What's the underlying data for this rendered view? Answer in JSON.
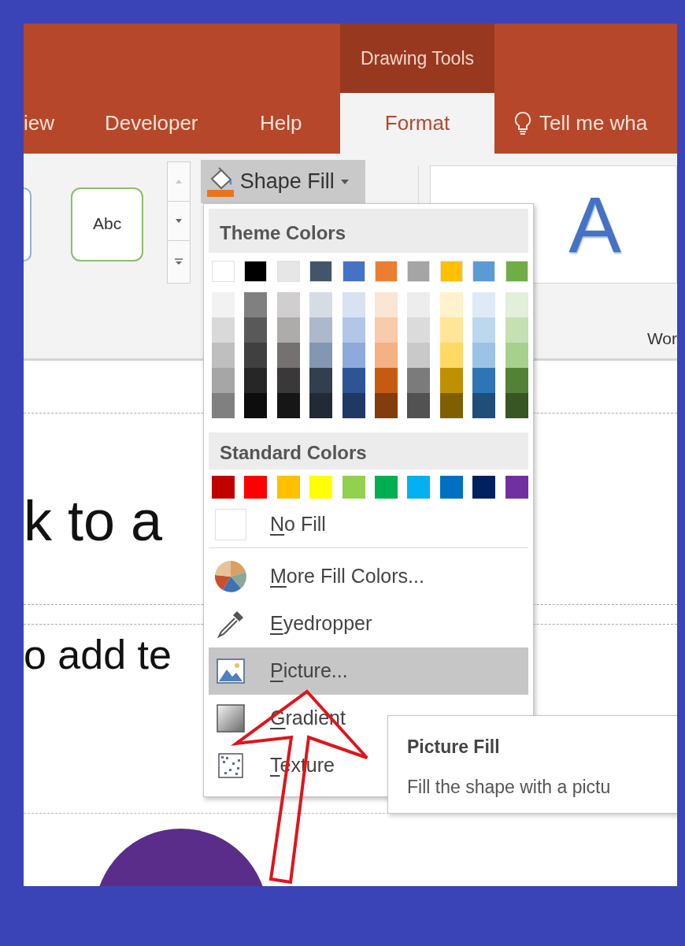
{
  "ribbon": {
    "contextual_label": "Drawing Tools",
    "tabs": [
      {
        "label": "iew",
        "selected": false
      },
      {
        "label": "Developer",
        "selected": false
      },
      {
        "label": "Help",
        "selected": false
      },
      {
        "label": "Format",
        "selected": true
      }
    ],
    "tell_me": "Tell me wha"
  },
  "gallery": {
    "style_preview": "Abc",
    "wordart_preview": "A",
    "group_label": "Wor"
  },
  "shape_fill_button": {
    "label": "Shape Fill",
    "expanded": true
  },
  "menu": {
    "theme_header": "Theme Colors",
    "theme_colors": [
      {
        "color": "#ffffff",
        "shades": [
          {
            "color": "#f2f2f2"
          },
          {
            "color": "#d9d9d9"
          },
          {
            "color": "#bfbfbf"
          },
          {
            "color": "#a6a6a6"
          },
          {
            "color": "#808080"
          }
        ]
      },
      {
        "color": "#000000",
        "shades": [
          {
            "color": "#808080"
          },
          {
            "color": "#595959"
          },
          {
            "color": "#404040"
          },
          {
            "color": "#262626"
          },
          {
            "color": "#0d0d0d"
          }
        ]
      },
      {
        "color": "#e7e6e6",
        "shades": [
          {
            "color": "#d0cece"
          },
          {
            "color": "#aeabab"
          },
          {
            "color": "#757171"
          },
          {
            "color": "#3a3838"
          },
          {
            "color": "#171616"
          }
        ]
      },
      {
        "color": "#44546a",
        "shades": [
          {
            "color": "#d6dce4"
          },
          {
            "color": "#adb9ca"
          },
          {
            "color": "#8497b0"
          },
          {
            "color": "#333f4f"
          },
          {
            "color": "#222a35"
          }
        ]
      },
      {
        "color": "#4472c4",
        "shades": [
          {
            "color": "#d9e2f3"
          },
          {
            "color": "#b4c6e7"
          },
          {
            "color": "#8eaadb"
          },
          {
            "color": "#2f5496"
          },
          {
            "color": "#1f3864"
          }
        ]
      },
      {
        "color": "#ed7d31",
        "shades": [
          {
            "color": "#fbe5d5"
          },
          {
            "color": "#f7cbac"
          },
          {
            "color": "#f4b183"
          },
          {
            "color": "#c55a11"
          },
          {
            "color": "#833c0b"
          }
        ]
      },
      {
        "color": "#a5a5a5",
        "shades": [
          {
            "color": "#ededed"
          },
          {
            "color": "#dbdbdb"
          },
          {
            "color": "#c9c9c9"
          },
          {
            "color": "#7b7b7b"
          },
          {
            "color": "#525252"
          }
        ]
      },
      {
        "color": "#ffc000",
        "shades": [
          {
            "color": "#fff2cc"
          },
          {
            "color": "#ffe699"
          },
          {
            "color": "#ffd966"
          },
          {
            "color": "#bf9000"
          },
          {
            "color": "#7f6000"
          }
        ]
      },
      {
        "color": "#5b9bd5",
        "shades": [
          {
            "color": "#deebf6"
          },
          {
            "color": "#bdd7ee"
          },
          {
            "color": "#9cc3e5"
          },
          {
            "color": "#2e75b5"
          },
          {
            "color": "#1e4e79"
          }
        ]
      },
      {
        "color": "#70ad47",
        "shades": [
          {
            "color": "#e2efd9"
          },
          {
            "color": "#c5e0b3"
          },
          {
            "color": "#a8d08d"
          },
          {
            "color": "#538135"
          },
          {
            "color": "#375623"
          }
        ]
      }
    ],
    "standard_header": "Standard Colors",
    "standard_colors": [
      {
        "color": "#c00000"
      },
      {
        "color": "#ff0000"
      },
      {
        "color": "#ffc000"
      },
      {
        "color": "#ffff00"
      },
      {
        "color": "#92d050"
      },
      {
        "color": "#00b050"
      },
      {
        "color": "#00b0f0"
      },
      {
        "color": "#0070c0"
      },
      {
        "color": "#002060"
      },
      {
        "color": "#7030a0"
      }
    ],
    "items": [
      {
        "kind": "no-fill",
        "label": "No Fill",
        "selected": false
      },
      {
        "kind": "more-colors",
        "label": "More Fill Colors...",
        "selected": false
      },
      {
        "kind": "eyedropper",
        "label": "Eyedropper",
        "selected": false
      },
      {
        "kind": "picture",
        "label": "Picture...",
        "selected": true
      },
      {
        "kind": "gradient",
        "label": "Gradient",
        "selected": false
      },
      {
        "kind": "texture",
        "label": "Texture",
        "selected": false
      }
    ]
  },
  "tooltip": {
    "title": "Picture Fill",
    "text": "Fill the shape with a pictu"
  },
  "slide": {
    "title_text": "k to a",
    "body_text": "o add te"
  }
}
